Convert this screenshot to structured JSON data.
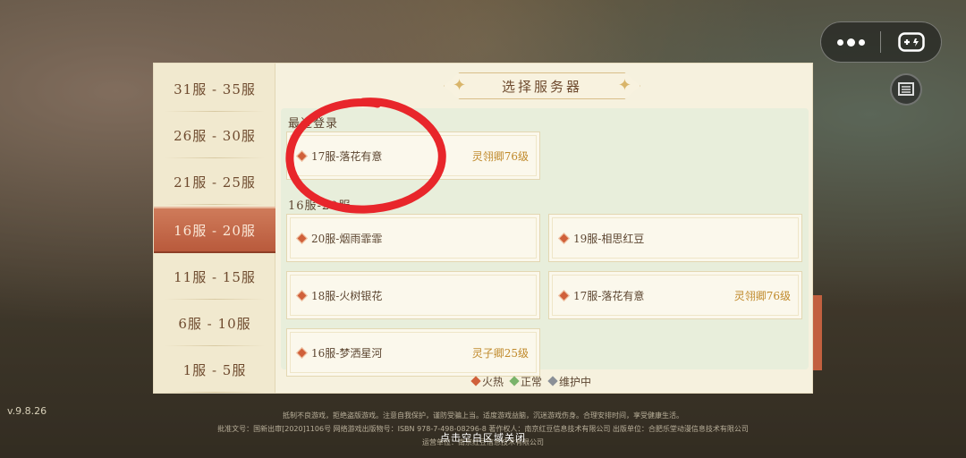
{
  "version": "v.9.8.26",
  "panel": {
    "title": "选择服务器"
  },
  "sidebar": {
    "items": [
      {
        "label": "31服 - 35服",
        "active": false
      },
      {
        "label": "26服 - 30服",
        "active": false
      },
      {
        "label": "21服 - 25服",
        "active": false
      },
      {
        "label": "16服 - 20服",
        "active": true
      },
      {
        "label": "11服 - 15服",
        "active": false
      },
      {
        "label": "6服 - 10服",
        "active": false
      },
      {
        "label": "1服 - 5服",
        "active": false
      }
    ]
  },
  "recent": {
    "label": "最近登录",
    "servers": [
      {
        "name": "17服-落花有意",
        "rank": "灵翎卿76级",
        "status": "hot"
      }
    ]
  },
  "group": {
    "label": "16服-20服",
    "servers": [
      {
        "name": "20服-烟雨霏霏",
        "rank": "",
        "status": "hot"
      },
      {
        "name": "19服-相思红豆",
        "rank": "",
        "status": "hot"
      },
      {
        "name": "18服-火树银花",
        "rank": "",
        "status": "hot"
      },
      {
        "name": "17服-落花有意",
        "rank": "灵翎卿76级",
        "status": "hot"
      },
      {
        "name": "16服-梦洒星河",
        "rank": "灵子卿25级",
        "status": "hot"
      }
    ]
  },
  "legend": [
    {
      "label": "火热",
      "color": "#d0603a"
    },
    {
      "label": "正常",
      "color": "#79b36a"
    },
    {
      "label": "维护中",
      "color": "#8a8f97"
    }
  ],
  "footer": {
    "line1": "抵制不良游戏，拒绝盗版游戏。注意自我保护，谨防受骗上当。适度游戏益脑，沉迷游戏伤身。合理安排时间，享受健康生活。",
    "line2": "批准文号：国新出审[2020]1106号 网络游戏出版物号：ISBN 978-7-498-08296-8 著作权人：南京红豆信息技术有限公司 出版单位：合肥乐堂动漫信息技术有限公司",
    "line3": "运营单位：南京红豆信息技术有限公司",
    "close_hint": "点击空白区域关闭"
  },
  "colors": {
    "accent": "#b95a3c",
    "hot": "#d0603a",
    "normal": "#79b36a",
    "maintenance": "#8a8f97",
    "annotation": "#e8262b"
  },
  "icons": {
    "more": "more-dots-icon",
    "game": "gamepad-icon",
    "badge": "book-icon"
  }
}
